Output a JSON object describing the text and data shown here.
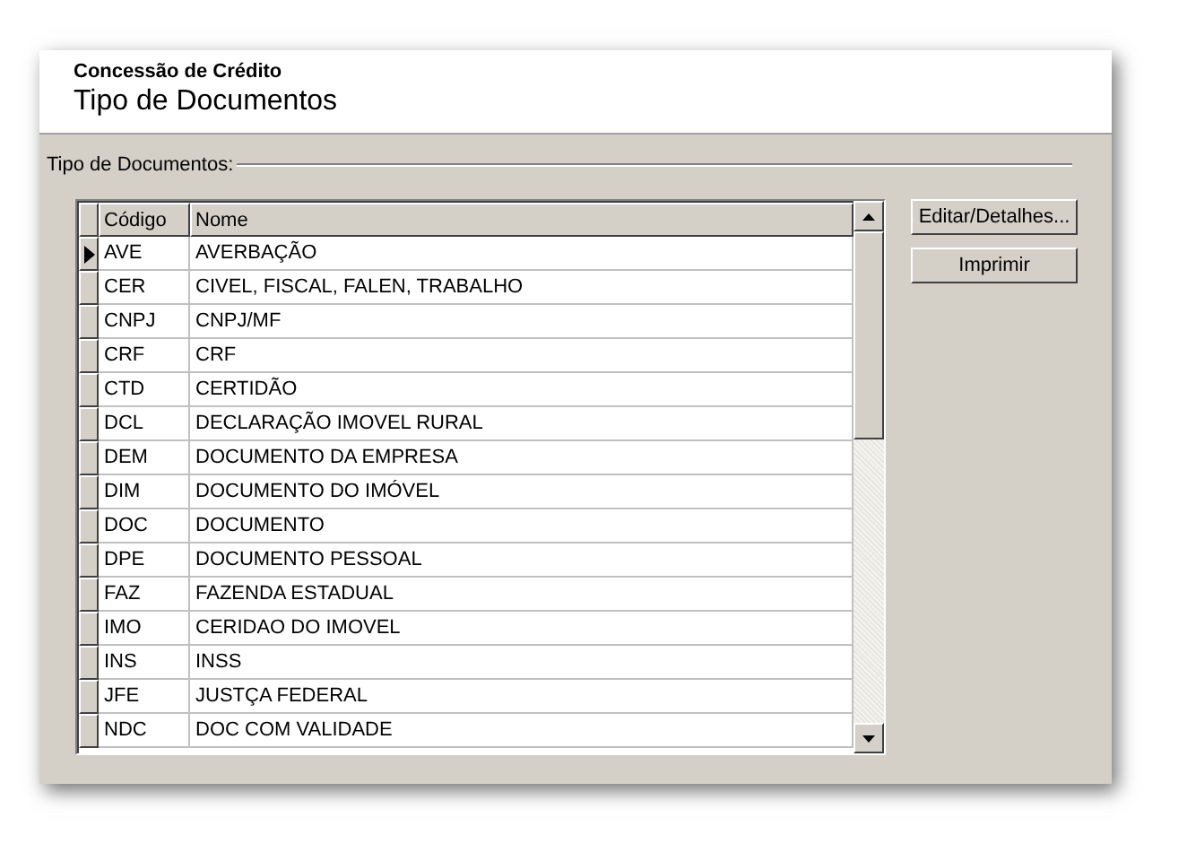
{
  "header": {
    "subtitle": "Concessão de Crédito",
    "title": "Tipo de Documentos"
  },
  "group_label": "Tipo de Documentos:",
  "table": {
    "columns": [
      "Código",
      "Nome"
    ],
    "rows": [
      {
        "codigo": "AVE",
        "nome": "AVERBAÇÃO",
        "selected": true
      },
      {
        "codigo": "CER",
        "nome": "CIVEL, FISCAL, FALEN, TRABALHO",
        "selected": false
      },
      {
        "codigo": "CNPJ",
        "nome": "CNPJ/MF",
        "selected": false
      },
      {
        "codigo": "CRF",
        "nome": "CRF",
        "selected": false
      },
      {
        "codigo": "CTD",
        "nome": "CERTIDÃO",
        "selected": false
      },
      {
        "codigo": "DCL",
        "nome": "DECLARAÇÃO IMOVEL RURAL",
        "selected": false
      },
      {
        "codigo": "DEM",
        "nome": "DOCUMENTO DA EMPRESA",
        "selected": false
      },
      {
        "codigo": "DIM",
        "nome": "DOCUMENTO DO IMÓVEL",
        "selected": false
      },
      {
        "codigo": "DOC",
        "nome": "DOCUMENTO",
        "selected": false
      },
      {
        "codigo": "DPE",
        "nome": "DOCUMENTO PESSOAL",
        "selected": false
      },
      {
        "codigo": "FAZ",
        "nome": "FAZENDA ESTADUAL",
        "selected": false
      },
      {
        "codigo": "IMO",
        "nome": "CERIDAO DO IMOVEL",
        "selected": false
      },
      {
        "codigo": "INS",
        "nome": "INSS",
        "selected": false
      },
      {
        "codigo": "JFE",
        "nome": "JUSTÇA FEDERAL",
        "selected": false
      },
      {
        "codigo": "NDC",
        "nome": "DOC COM VALIDADE",
        "selected": false
      }
    ]
  },
  "buttons": [
    "Editar/Detalhes...",
    "Imprimir"
  ]
}
